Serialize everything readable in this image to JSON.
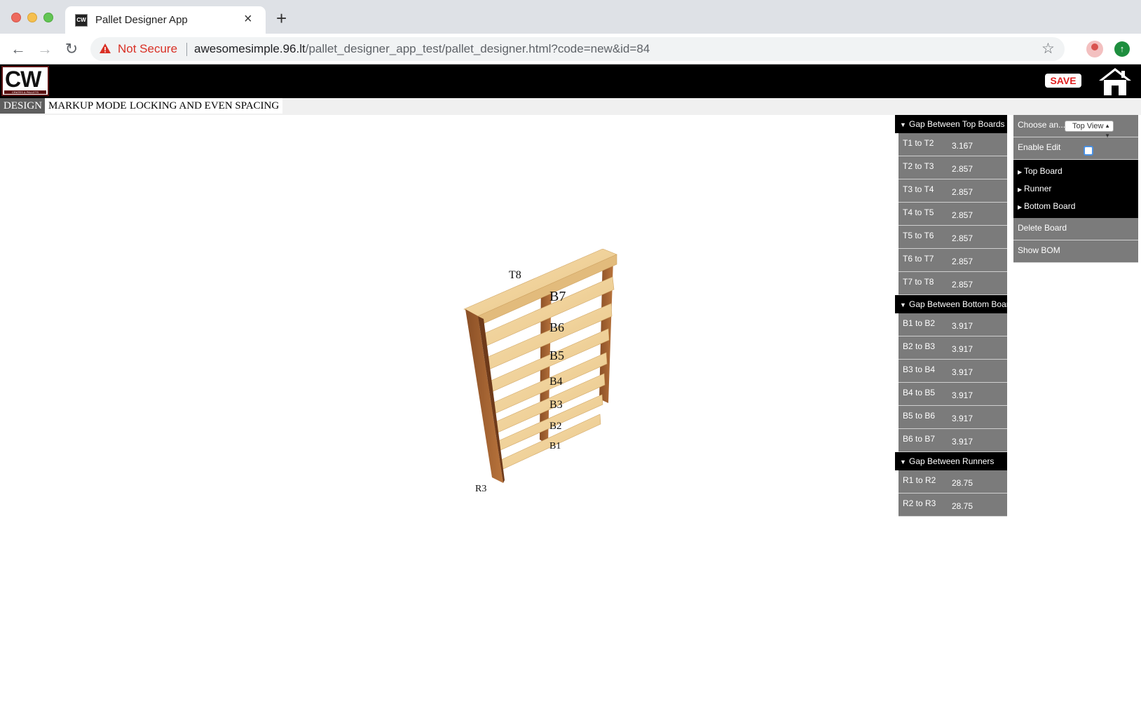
{
  "browser": {
    "tab_title": "Pallet Designer App",
    "tab_favicon_text": "CW",
    "security_label": "Not Secure",
    "url_host": "awesomesimple.96.lt",
    "url_path": "/pallet_designer_app_test/pallet_designer.html?code=new&id=84"
  },
  "header": {
    "logo_text": "CW",
    "logo_subtext": "CRATES & PALLETS",
    "save_label": "SAVE"
  },
  "modes": {
    "design": "DESIGN",
    "markup": "MARKUP MODE",
    "locking": "LOCKING AND EVEN SPACING"
  },
  "viewer": {
    "labels": [
      "T8",
      "B7",
      "B6",
      "B5",
      "B4",
      "B3",
      "B2",
      "B1",
      "R3"
    ]
  },
  "gaps": {
    "top_header": "Gap Between Top Boards",
    "top": [
      {
        "label": "T1 to T2",
        "value": "3.167"
      },
      {
        "label": "T2 to T3",
        "value": "2.857"
      },
      {
        "label": "T3 to T4",
        "value": "2.857"
      },
      {
        "label": "T4 to T5",
        "value": "2.857"
      },
      {
        "label": "T5 to T6",
        "value": "2.857"
      },
      {
        "label": "T6 to T7",
        "value": "2.857"
      },
      {
        "label": "T7 to T8",
        "value": "2.857"
      }
    ],
    "bottom_header": "Gap Between Bottom Boards",
    "bottom": [
      {
        "label": "B1 to B2",
        "value": "3.917"
      },
      {
        "label": "B2 to B3",
        "value": "3.917"
      },
      {
        "label": "B3 to B4",
        "value": "3.917"
      },
      {
        "label": "B4 to B5",
        "value": "3.917"
      },
      {
        "label": "B5 to B6",
        "value": "3.917"
      },
      {
        "label": "B6 to B7",
        "value": "3.917"
      }
    ],
    "runners_header": "Gap Between Runners",
    "runners": [
      {
        "label": "R1 to R2",
        "value": "28.75"
      },
      {
        "label": "R2 to R3",
        "value": "28.75"
      }
    ]
  },
  "menu": {
    "choose_label": "Choose an...",
    "view_selected": "Top View",
    "enable_edit_label": "Enable Edit",
    "enable_edit_checked": false,
    "board_types": [
      "Top Board",
      "Runner",
      "Bottom Board"
    ],
    "delete_label": "Delete Board",
    "bom_label": "Show BOM"
  },
  "colors": {
    "brand_red": "#e02020",
    "panel_gray": "#7b7b7b",
    "header_black": "#000000"
  }
}
